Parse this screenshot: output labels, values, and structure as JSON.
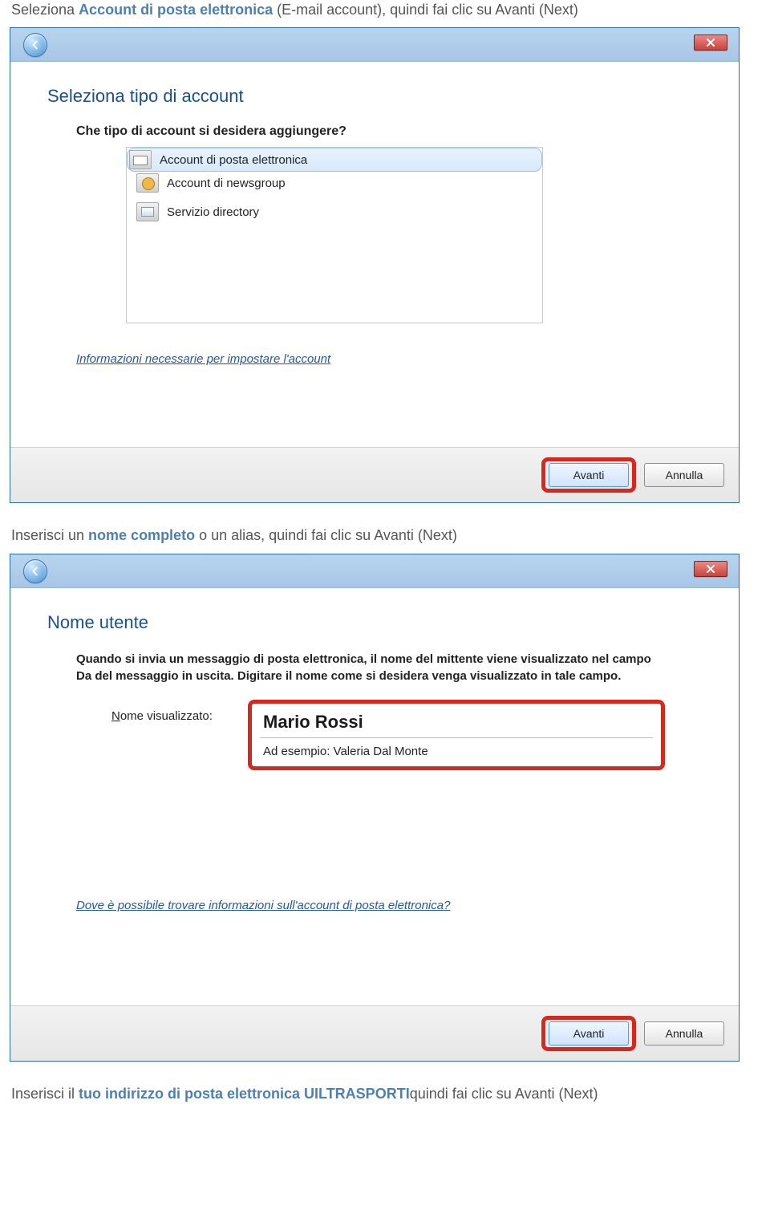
{
  "instruction1": {
    "pre": "Seleziona ",
    "hl": "Account di posta elettronica",
    "post": " (E-mail account), quindi fai clic su Avanti (Next)"
  },
  "wiz1": {
    "title": "Seleziona tipo di account",
    "question": "Che tipo di account si desidera aggiungere?",
    "options": {
      "email": "Account di posta elettronica",
      "news": "Account di newsgroup",
      "dir": "Servizio directory"
    },
    "help_link": "Informazioni necessarie per impostare l'account",
    "next": "Avanti",
    "cancel": "Annulla"
  },
  "instruction2": {
    "pre": "Inserisci un ",
    "hl": "nome completo",
    "post": " o un alias, quindi fai clic su Avanti (Next)"
  },
  "wiz2": {
    "title": "Nome utente",
    "desc": "Quando si invia un messaggio di posta elettronica, il nome del mittente viene visualizzato nel campo Da del messaggio in uscita. Digitare il nome come si desidera venga visualizzato in tale campo.",
    "label_pre": "N",
    "label_post": "ome visualizzato:",
    "name_value": "Mario Rossi",
    "example": "Ad esempio: Valeria Dal Monte",
    "help_link": "Dove è possibile trovare informazioni sull'account di posta elettronica?",
    "next": "Avanti",
    "cancel": "Annulla"
  },
  "instruction3": {
    "pre": "Inserisci il ",
    "hl": "tuo indirizzo di posta elettronica UILTRASPORTI",
    "post": "quindi fai clic su Avanti (Next)"
  }
}
